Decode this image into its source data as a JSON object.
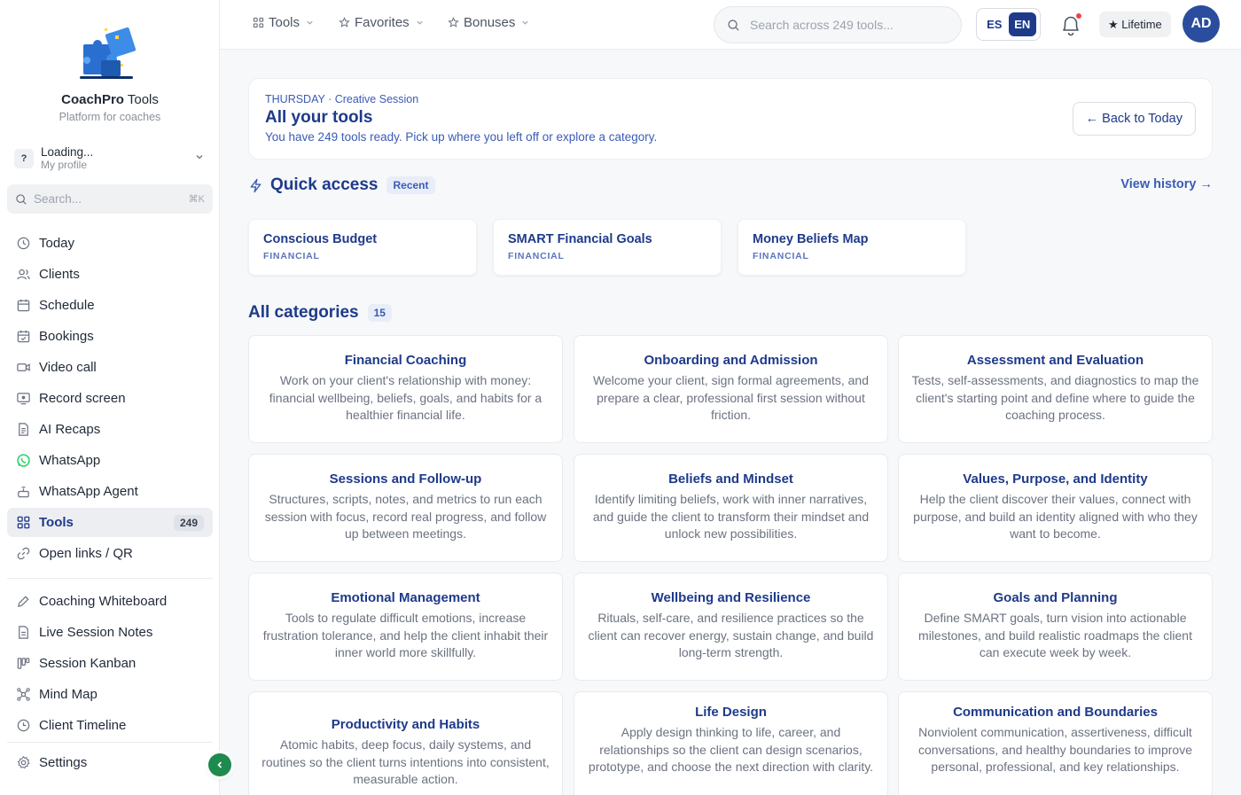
{
  "brand": {
    "name_bold": "CoachPro",
    "name_rest": " Tools",
    "subtitle": "Platform for coaches"
  },
  "profile": {
    "avatar": "?",
    "name": "Loading...",
    "subtitle": "My profile"
  },
  "sidebar_search": {
    "placeholder": "Search...",
    "shortcut": "⌘K"
  },
  "nav": {
    "items": [
      {
        "label": "Today",
        "icon": "clock-icon"
      },
      {
        "label": "Clients",
        "icon": "users-icon"
      },
      {
        "label": "Schedule",
        "icon": "calendar-icon"
      },
      {
        "label": "Bookings",
        "icon": "calendar-check-icon"
      },
      {
        "label": "Video call",
        "icon": "video-icon"
      },
      {
        "label": "Record screen",
        "icon": "screen-record-icon"
      },
      {
        "label": "AI Recaps",
        "icon": "document-icon"
      },
      {
        "label": "WhatsApp",
        "icon": "whatsapp-icon"
      },
      {
        "label": "WhatsApp Agent",
        "icon": "bot-icon"
      },
      {
        "label": "Tools",
        "icon": "grid-icon",
        "badge": "249",
        "active": true
      },
      {
        "label": "Open links / QR",
        "icon": "link-icon"
      }
    ],
    "workspace": [
      {
        "label": "Coaching Whiteboard",
        "icon": "pen-icon"
      },
      {
        "label": "Live Session Notes",
        "icon": "notes-icon"
      },
      {
        "label": "Session Kanban",
        "icon": "kanban-icon"
      },
      {
        "label": "Mind Map",
        "icon": "mind-map-icon"
      },
      {
        "label": "Client Timeline",
        "icon": "timeline-icon"
      }
    ],
    "settings": {
      "label": "Settings",
      "icon": "gear-icon"
    }
  },
  "topbar": {
    "menus": [
      {
        "label": "Tools",
        "icon": "grid-icon"
      },
      {
        "label": "Favorites",
        "icon": "star-icon"
      },
      {
        "label": "Bonuses",
        "icon": "star-icon"
      }
    ],
    "search_placeholder": "Search across 249 tools...",
    "languages": [
      "ES",
      "EN"
    ],
    "active_language": "EN",
    "plan": "★ Lifetime",
    "avatar_initials": "AD"
  },
  "hero": {
    "eyebrow": "THURSDAY · Creative Session",
    "title": "All your tools",
    "subtitle": "You have 249 tools ready. Pick up where you left off or explore a category.",
    "back_button": "← Back to Today"
  },
  "quick_access": {
    "title": "Quick access",
    "badge": "Recent",
    "view_history": "View history →",
    "cards": [
      {
        "title": "Conscious Budget",
        "tag": "FINANCIAL"
      },
      {
        "title": "SMART Financial Goals",
        "tag": "FINANCIAL"
      },
      {
        "title": "Money Beliefs Map",
        "tag": "FINANCIAL"
      }
    ]
  },
  "categories": {
    "title": "All categories",
    "count": "15",
    "items": [
      {
        "title": "Financial Coaching",
        "description": "Work on your client's relationship with money: financial wellbeing, beliefs, goals, and habits for a healthier financial life."
      },
      {
        "title": "Onboarding and Admission",
        "description": "Welcome your client, sign formal agreements, and prepare a clear, professional first session without friction."
      },
      {
        "title": "Assessment and Evaluation",
        "description": "Tests, self-assessments, and diagnostics to map the client's starting point and define where to guide the coaching process."
      },
      {
        "title": "Sessions and Follow-up",
        "description": "Structures, scripts, notes, and metrics to run each session with focus, record real progress, and follow up between meetings."
      },
      {
        "title": "Beliefs and Mindset",
        "description": "Identify limiting beliefs, work with inner narratives, and guide the client to transform their mindset and unlock new possibilities."
      },
      {
        "title": "Values, Purpose, and Identity",
        "description": "Help the client discover their values, connect with purpose, and build an identity aligned with who they want to become."
      },
      {
        "title": "Emotional Management",
        "description": "Tools to regulate difficult emotions, increase frustration tolerance, and help the client inhabit their inner world more skillfully."
      },
      {
        "title": "Wellbeing and Resilience",
        "description": "Rituals, self-care, and resilience practices so the client can recover energy, sustain change, and build long-term strength."
      },
      {
        "title": "Goals and Planning",
        "description": "Define SMART goals, turn vision into actionable milestones, and build realistic roadmaps the client can execute week by week."
      },
      {
        "title": "Productivity and Habits",
        "description": "Atomic habits, deep focus, daily systems, and routines so the client turns intentions into consistent, measurable action."
      },
      {
        "title": "Life Design",
        "description": "Apply design thinking to life, career, and relationships so the client can design scenarios, prototype, and choose the next direction with clarity."
      },
      {
        "title": "Communication and Boundaries",
        "description": "Nonviolent communication, assertiveness, difficult conversations, and healthy boundaries to improve personal, professional, and key relationships."
      }
    ]
  },
  "colors": {
    "primary": "#1e3a8a",
    "accent": "#3b5bb5",
    "whatsapp": "#25d366",
    "collapse": "#1e8a4d",
    "notification": "#ef4444"
  }
}
